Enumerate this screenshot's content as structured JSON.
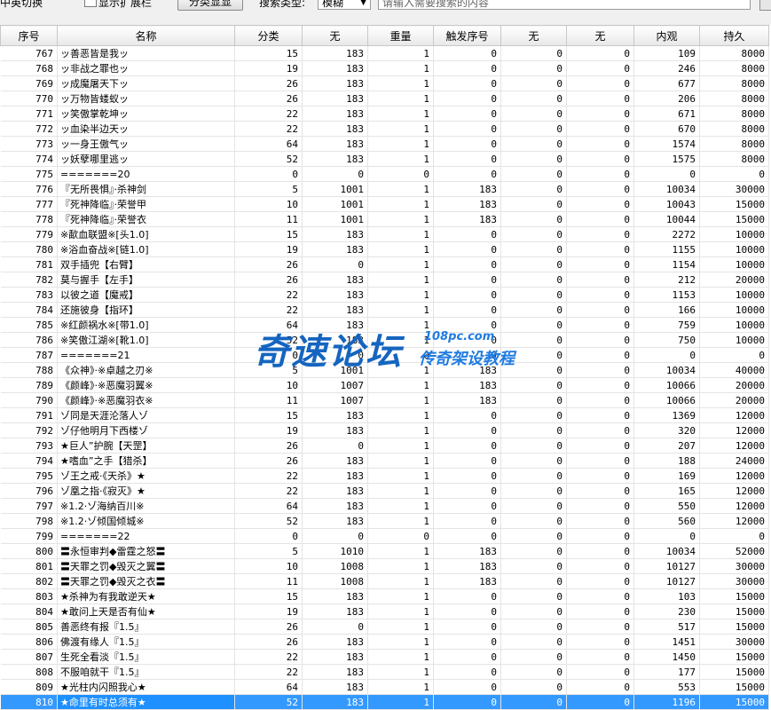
{
  "toolbar": {
    "mode_label": "中英切换",
    "show_ext_label": "显示扩展栏",
    "classify_button": "分类显显",
    "search_type_label": "搜索类型:",
    "search_type_value": "模糊",
    "search_placeholder": "请输入需要搜索的内容"
  },
  "columns": [
    "序号",
    "名称",
    "分类",
    "无",
    "重量",
    "触发序号",
    "无",
    "无",
    "内观",
    "持久"
  ],
  "rows": [
    [
      "767",
      "ッ善恶皆是我ッ",
      "15",
      "183",
      "1",
      "0",
      "0",
      "0",
      "109",
      "8000"
    ],
    [
      "768",
      "ッ非战之罪也ッ",
      "19",
      "183",
      "1",
      "0",
      "0",
      "0",
      "246",
      "8000"
    ],
    [
      "769",
      "ッ成魔屠天下ッ",
      "26",
      "183",
      "1",
      "0",
      "0",
      "0",
      "677",
      "8000"
    ],
    [
      "770",
      "ッ万物皆蝼蚁ッ",
      "26",
      "183",
      "1",
      "0",
      "0",
      "0",
      "206",
      "8000"
    ],
    [
      "771",
      "ッ笑傲掌乾坤ッ",
      "22",
      "183",
      "1",
      "0",
      "0",
      "0",
      "671",
      "8000"
    ],
    [
      "772",
      "ッ血染半边天ッ",
      "22",
      "183",
      "1",
      "0",
      "0",
      "0",
      "670",
      "8000"
    ],
    [
      "773",
      "ッ一身王傲气ッ",
      "64",
      "183",
      "1",
      "0",
      "0",
      "0",
      "1574",
      "8000"
    ],
    [
      "774",
      "ッ妖孽哪里逃ッ",
      "52",
      "183",
      "1",
      "0",
      "0",
      "0",
      "1575",
      "8000"
    ],
    [
      "775",
      "=======20",
      "0",
      "0",
      "0",
      "0",
      "0",
      "0",
      "0",
      "0"
    ],
    [
      "776",
      "『无所畏惧』·杀神剑",
      "5",
      "1001",
      "1",
      "183",
      "0",
      "0",
      "10034",
      "30000"
    ],
    [
      "777",
      "『死神降临』·荣誉甲",
      "10",
      "1001",
      "1",
      "183",
      "0",
      "0",
      "10043",
      "15000"
    ],
    [
      "778",
      "『死神降临』·荣誉衣",
      "11",
      "1001",
      "1",
      "183",
      "0",
      "0",
      "10044",
      "15000"
    ],
    [
      "779",
      "※歃血联盟※[头1.0]",
      "15",
      "183",
      "1",
      "0",
      "0",
      "0",
      "2272",
      "10000"
    ],
    [
      "780",
      "※浴血奋战※[链1.0]",
      "19",
      "183",
      "1",
      "0",
      "0",
      "0",
      "1155",
      "10000"
    ],
    [
      "781",
      "双手插兜【右臂】",
      "26",
      "0",
      "1",
      "0",
      "0",
      "0",
      "1154",
      "10000"
    ],
    [
      "782",
      "莫与握手【左手】",
      "26",
      "183",
      "1",
      "0",
      "0",
      "0",
      "212",
      "20000"
    ],
    [
      "783",
      "以彼之道【魔戒】",
      "22",
      "183",
      "1",
      "0",
      "0",
      "0",
      "1153",
      "10000"
    ],
    [
      "784",
      "还施彼身【指环】",
      "22",
      "183",
      "1",
      "0",
      "0",
      "0",
      "166",
      "10000"
    ],
    [
      "785",
      "※红颜祸水※[带1.0]",
      "64",
      "183",
      "1",
      "0",
      "0",
      "0",
      "759",
      "10000"
    ],
    [
      "786",
      "※笑傲江湖※[靴1.0]",
      "52",
      "183",
      "1",
      "0",
      "0",
      "0",
      "750",
      "10000"
    ],
    [
      "787",
      "=======21",
      "0",
      "0",
      "0",
      "0",
      "0",
      "0",
      "0",
      "0"
    ],
    [
      "788",
      "《众神》·※卓越之刃※",
      "5",
      "1001",
      "1",
      "183",
      "0",
      "0",
      "10034",
      "40000"
    ],
    [
      "789",
      "《颜峰》·※恶魔羽翼※",
      "10",
      "1007",
      "1",
      "183",
      "0",
      "0",
      "10066",
      "20000"
    ],
    [
      "790",
      "《颜峰》·※恶魔羽衣※",
      "11",
      "1007",
      "1",
      "183",
      "0",
      "0",
      "10066",
      "20000"
    ],
    [
      "791",
      "ゾ同是天涯沦落人ゾ",
      "15",
      "183",
      "1",
      "0",
      "0",
      "0",
      "1369",
      "12000"
    ],
    [
      "792",
      "ゾ仔他明月下西楼ゾ",
      "19",
      "183",
      "1",
      "0",
      "0",
      "0",
      "320",
      "12000"
    ],
    [
      "793",
      "★巨人”护腕【天罡】",
      "26",
      "0",
      "1",
      "0",
      "0",
      "0",
      "207",
      "12000"
    ],
    [
      "794",
      "★嗜血”之手【猎杀】",
      "26",
      "183",
      "1",
      "0",
      "0",
      "0",
      "188",
      "24000"
    ],
    [
      "795",
      "ゾ王之戒·《天杀》★",
      "22",
      "183",
      "1",
      "0",
      "0",
      "0",
      "169",
      "12000"
    ],
    [
      "796",
      "ゾ凰之指·《寂灭》★",
      "22",
      "183",
      "1",
      "0",
      "0",
      "0",
      "165",
      "12000"
    ],
    [
      "797",
      "※1.2·ゾ海纳百川※",
      "64",
      "183",
      "1",
      "0",
      "0",
      "0",
      "550",
      "12000"
    ],
    [
      "798",
      "※1.2·ゾ倾国倾城※",
      "52",
      "183",
      "1",
      "0",
      "0",
      "0",
      "560",
      "12000"
    ],
    [
      "799",
      "=======22",
      "0",
      "0",
      "0",
      "0",
      "0",
      "0",
      "0",
      "0"
    ],
    [
      "800",
      "〓永恒审判◆雷霆之怒〓",
      "5",
      "1010",
      "1",
      "183",
      "0",
      "0",
      "10034",
      "52000"
    ],
    [
      "801",
      "〓天罪之罚◆毁灭之翼〓",
      "10",
      "1008",
      "1",
      "183",
      "0",
      "0",
      "10127",
      "30000"
    ],
    [
      "802",
      "〓天罪之罚◆毁灭之衣〓",
      "11",
      "1008",
      "1",
      "183",
      "0",
      "0",
      "10127",
      "30000"
    ],
    [
      "803",
      "★杀神为有我敢逆天★",
      "15",
      "183",
      "1",
      "0",
      "0",
      "0",
      "103",
      "15000"
    ],
    [
      "804",
      "★敢问上天是否有仙★",
      "19",
      "183",
      "1",
      "0",
      "0",
      "0",
      "230",
      "15000"
    ],
    [
      "805",
      "善恶终有报『1.5』",
      "26",
      "0",
      "1",
      "0",
      "0",
      "0",
      "517",
      "15000"
    ],
    [
      "806",
      "佛渡有缘人『1.5』",
      "26",
      "183",
      "1",
      "0",
      "0",
      "0",
      "1451",
      "30000"
    ],
    [
      "807",
      "生死全看淡『1.5』",
      "22",
      "183",
      "1",
      "0",
      "0",
      "0",
      "1450",
      "15000"
    ],
    [
      "808",
      "不服咱就干『1.5』",
      "22",
      "183",
      "1",
      "0",
      "0",
      "0",
      "177",
      "15000"
    ],
    [
      "809",
      "★光柱内闪照我心★",
      "64",
      "183",
      "1",
      "0",
      "0",
      "0",
      "553",
      "15000"
    ],
    [
      "810",
      "★命里有时总须有★",
      "52",
      "183",
      "1",
      "0",
      "0",
      "0",
      "1196",
      "15000"
    ]
  ],
  "selected_row": "810",
  "watermark": {
    "main": "奇速论坛",
    "url": "108pc.com",
    "sub": "传奇架设教程"
  }
}
